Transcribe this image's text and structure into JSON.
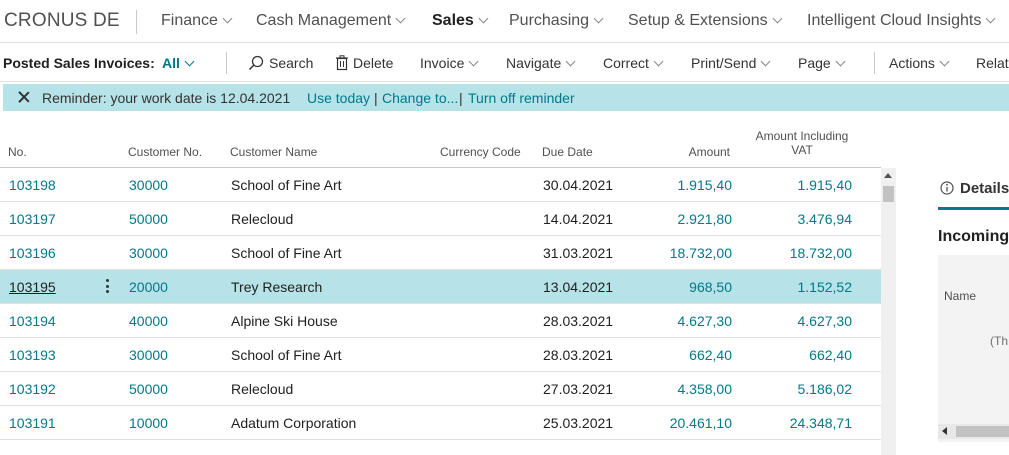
{
  "app": {
    "company": "CRONUS DE"
  },
  "nav": {
    "items": [
      {
        "label": "Finance",
        "active": false
      },
      {
        "label": "Cash Management",
        "active": false
      },
      {
        "label": "Sales",
        "active": true
      },
      {
        "label": "Purchasing",
        "active": false
      },
      {
        "label": "Setup & Extensions",
        "active": false
      },
      {
        "label": "Intelligent Cloud Insights",
        "active": false
      }
    ]
  },
  "toolbar": {
    "page_title": "Posted Sales Invoices:",
    "filter": "All",
    "search": "Search",
    "delete": "Delete",
    "invoice": "Invoice",
    "navigate": "Navigate",
    "correct": "Correct",
    "print_send": "Print/Send",
    "page": "Page",
    "actions": "Actions",
    "related": "Relate"
  },
  "reminder": {
    "text": "Reminder: your work date is 12.04.2021",
    "use_today": "Use today",
    "change_to": "Change to...",
    "turn_off": "Turn off reminder",
    "separator": "|"
  },
  "table": {
    "headers": {
      "no": "No.",
      "customer_no": "Customer No.",
      "customer_name": "Customer Name",
      "currency_code": "Currency Code",
      "due_date": "Due Date",
      "amount": "Amount",
      "amount_incl_vat_line1": "Amount Including",
      "amount_incl_vat_line2": "VAT"
    },
    "rows": [
      {
        "no": "103198",
        "customer_no": "30000",
        "customer_name": "School of Fine Art",
        "currency_code": "",
        "due_date": "30.04.2021",
        "amount": "1.915,40",
        "amount_incl_vat": "1.915,40",
        "selected": false
      },
      {
        "no": "103197",
        "customer_no": "50000",
        "customer_name": "Relecloud",
        "currency_code": "",
        "due_date": "14.04.2021",
        "amount": "2.921,80",
        "amount_incl_vat": "3.476,94",
        "selected": false
      },
      {
        "no": "103196",
        "customer_no": "30000",
        "customer_name": "School of Fine Art",
        "currency_code": "",
        "due_date": "31.03.2021",
        "amount": "18.732,00",
        "amount_incl_vat": "18.732,00",
        "selected": false
      },
      {
        "no": "103195",
        "customer_no": "20000",
        "customer_name": "Trey Research",
        "currency_code": "",
        "due_date": "13.04.2021",
        "amount": "968,50",
        "amount_incl_vat": "1.152,52",
        "selected": true
      },
      {
        "no": "103194",
        "customer_no": "40000",
        "customer_name": "Alpine Ski House",
        "currency_code": "",
        "due_date": "28.03.2021",
        "amount": "4.627,30",
        "amount_incl_vat": "4.627,30",
        "selected": false
      },
      {
        "no": "103193",
        "customer_no": "30000",
        "customer_name": "School of Fine Art",
        "currency_code": "",
        "due_date": "28.03.2021",
        "amount": "662,40",
        "amount_incl_vat": "662,40",
        "selected": false
      },
      {
        "no": "103192",
        "customer_no": "50000",
        "customer_name": "Relecloud",
        "currency_code": "",
        "due_date": "27.03.2021",
        "amount": "4.358,00",
        "amount_incl_vat": "5.186,02",
        "selected": false
      },
      {
        "no": "103191",
        "customer_no": "10000",
        "customer_name": "Adatum Corporation",
        "currency_code": "",
        "due_date": "25.03.2021",
        "amount": "20.461,10",
        "amount_incl_vat": "24.348,71",
        "selected": false
      }
    ]
  },
  "factbox": {
    "tab": "Details",
    "title": "Incoming",
    "name_label": "Name",
    "empty_text": "(Th"
  },
  "colors": {
    "accent": "#00798a",
    "selection": "#b6e3e8"
  }
}
